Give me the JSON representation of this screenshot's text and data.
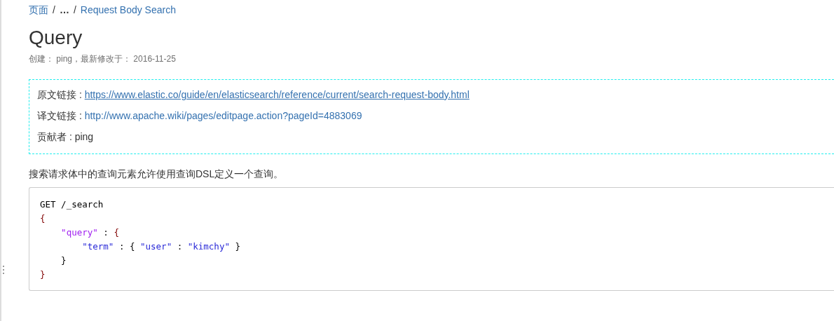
{
  "breadcrumb": [
    {
      "text": "页面",
      "kind": "link"
    },
    {
      "text": "/",
      "kind": "separator"
    },
    {
      "text": "…",
      "kind": "ellipsis"
    },
    {
      "text": "/",
      "kind": "separator"
    },
    {
      "text": "Request Body Search",
      "kind": "link"
    }
  ],
  "title": "Query",
  "meta": "创建： ping，最新修改于： 2016-11-25",
  "info_box": [
    {
      "label": "原文链接 : ",
      "value": "https://www.elastic.co/guide/en/elasticsearch/reference/current/search-request-body.html",
      "kind": "underlined-link"
    },
    {
      "label": "译文链接 : ",
      "value": "http://www.apache.wiki/pages/editpage.action?pageId=4883069",
      "kind": "link"
    },
    {
      "label": "贡献者 : ",
      "value": "ping",
      "kind": "text"
    }
  ],
  "intro": "搜索请求体中的查询元素允许使用查询DSL定义一个查询。",
  "code": [
    [
      {
        "text": "GET /_search",
        "kind": "plain"
      }
    ],
    [
      {
        "text": "{",
        "kind": "brace"
      }
    ],
    [
      {
        "text": "    \"query\"",
        "kind": "key"
      },
      {
        "text": " : ",
        "kind": "plain"
      },
      {
        "text": "{",
        "kind": "brace"
      }
    ],
    [
      {
        "text": "        \"term\"",
        "kind": "string"
      },
      {
        "text": " : { ",
        "kind": "plain"
      },
      {
        "text": "\"user\"",
        "kind": "string"
      },
      {
        "text": " : ",
        "kind": "plain"
      },
      {
        "text": "\"kimchy\"",
        "kind": "string"
      },
      {
        "text": " }",
        "kind": "plain"
      }
    ],
    [
      {
        "text": "    }",
        "kind": "plain"
      }
    ],
    [
      {
        "text": "}",
        "kind": "brace"
      }
    ]
  ]
}
